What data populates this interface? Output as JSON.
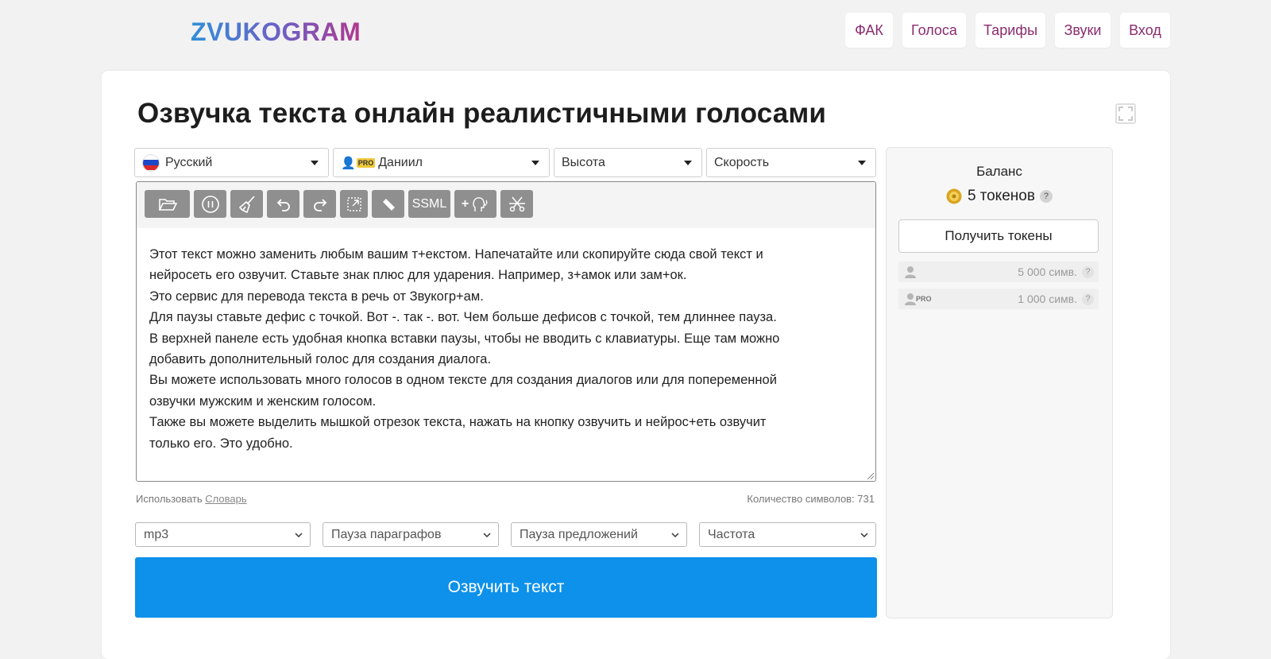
{
  "header": {
    "logo_text": "ZVUKOGRAM",
    "nav": [
      "ФАК",
      "Голоса",
      "Тарифы",
      "Звуки",
      "Вход"
    ]
  },
  "main": {
    "title": "Озвучка текста онлайн реалистичными голосами",
    "selects": {
      "language": "Русский",
      "voice": "Даниил",
      "voice_badge": "PRO",
      "pitch": "Высота",
      "speed": "Скорость"
    },
    "toolbar": {
      "ssml_label": "SSML",
      "add_voice_label": "+"
    },
    "editor_text": "Этот текст можно заменить любым вашим т+екстом. Напечатайте или скопируйте сюда свой текст и\nнейросеть его озвучит. Ставьте знак плюс для ударения. Например, з+амок или зам+ок.\nЭто сервис для перевода текста в речь от Звукогр+ам.\nДля паузы ставьте дефис с точкой. Вот -. так -. вот. Чем больше дефисов с точкой, тем длиннее пауза.\nВ верхней панеле есть удобная кнопка вставки паузы, чтобы не вводить с клавиатуры. Еще там можно\nдобавить дополнительный голос для создания диалога.\nВы можете использовать много голосов в одном тексте для создания диалогов или для попеременной\nозвучки мужским и женским голосом.\nТакже вы можете выделить мышкой отрезок текста, нажать на кнопку озвучить и нейрос+еть озвучит\nтолько его. Это удобно.",
    "dict_prefix": "Использовать",
    "dict_link": "Словарь",
    "char_count": "Количество символов: 731",
    "options": {
      "format": "mp3",
      "paragraph_pause": "Пауза параграфов",
      "sentence_pause": "Пауза предложений",
      "frequency": "Частота"
    },
    "speak_button": "Озвучить текст"
  },
  "sidebar": {
    "balance_title": "Баланс",
    "balance_amount": "5",
    "balance_unit": "токенов",
    "help": "?",
    "get_tokens": "Получить токены",
    "plans": [
      {
        "badge": "",
        "value": "5 000 симв."
      },
      {
        "badge": "PRO",
        "value": "1 000 симв."
      }
    ]
  },
  "colors": {
    "accent_button": "#0d91ea",
    "nav_text": "#8a2c6e",
    "toolbar_button": "#8f8f8f",
    "pro_badge": "#f0c93c"
  }
}
